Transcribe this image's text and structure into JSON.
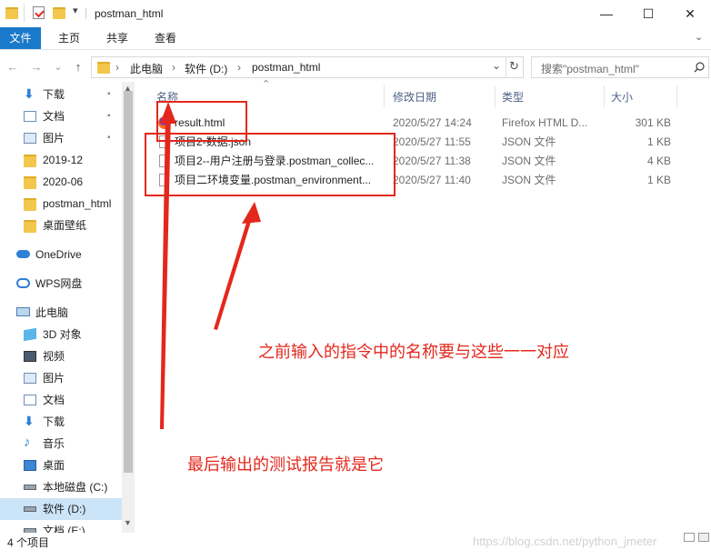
{
  "titlebar": {
    "title": "postman_html",
    "minimize_glyph": "—",
    "maximize_glyph": "☐",
    "close_glyph": "✕"
  },
  "ribbon": {
    "tabs": [
      "文件",
      "主页",
      "共享",
      "查看"
    ]
  },
  "nav": {
    "back_glyph": "←",
    "forward_glyph": "→",
    "recent_glyph": "⌄",
    "up_glyph": "↑",
    "breadcrumb": [
      "此电脑",
      "软件 (D:)",
      "postman_html"
    ],
    "separator": "›",
    "dropdown_glyph": "⌄",
    "refresh_glyph": "↻",
    "search_placeholder": "搜索\"postman_html\"",
    "search_icon": "search-icon"
  },
  "sidebar": {
    "items": [
      {
        "label": "下载",
        "icon": "download-icon",
        "pinned": true
      },
      {
        "label": "文档",
        "icon": "document-icon",
        "pinned": true
      },
      {
        "label": "图片",
        "icon": "picture-icon",
        "pinned": true
      },
      {
        "label": "2019-12",
        "icon": "folder-icon"
      },
      {
        "label": "2020-06",
        "icon": "folder-icon"
      },
      {
        "label": "postman_html",
        "icon": "folder-icon"
      },
      {
        "label": "桌面壁纸",
        "icon": "folder-icon"
      },
      {
        "label": "OneDrive",
        "icon": "cloud-icon"
      },
      {
        "label": "WPS网盘",
        "icon": "wps-cloud-icon"
      },
      {
        "label": "此电脑",
        "icon": "computer-icon"
      },
      {
        "label": "3D 对象",
        "icon": "3d-objects-icon"
      },
      {
        "label": "视频",
        "icon": "video-icon"
      },
      {
        "label": "图片",
        "icon": "picture-icon"
      },
      {
        "label": "文档",
        "icon": "document-icon"
      },
      {
        "label": "下载",
        "icon": "download-icon"
      },
      {
        "label": "音乐",
        "icon": "music-icon"
      },
      {
        "label": "桌面",
        "icon": "desktop-icon"
      },
      {
        "label": "本地磁盘 (C:)",
        "icon": "drive-icon"
      },
      {
        "label": "软件 (D:)",
        "icon": "drive-icon",
        "selected": true
      },
      {
        "label": "文档 (E:)",
        "icon": "drive-icon"
      }
    ],
    "pin_glyph": "📌"
  },
  "filelist": {
    "columns": [
      "名称",
      "修改日期",
      "类型",
      "大小"
    ],
    "sort_glyph": "⌃",
    "rows": [
      {
        "name": "result.html",
        "date": "2020/5/27 14:24",
        "type": "Firefox HTML D...",
        "size": "301 KB",
        "icon": "firefox-html-icon"
      },
      {
        "name": "项目2-数据.json",
        "date": "2020/5/27 11:55",
        "type": "JSON 文件",
        "size": "1 KB",
        "icon": "file-icon"
      },
      {
        "name": "项目2--用户注册与登录.postman_collec...",
        "date": "2020/5/27 11:38",
        "type": "JSON 文件",
        "size": "4 KB",
        "icon": "file-icon"
      },
      {
        "name": "项目二环境变量.postman_environment...",
        "date": "2020/5/27 11:40",
        "type": "JSON 文件",
        "size": "1 KB",
        "icon": "file-icon"
      }
    ]
  },
  "annotations": {
    "note1": "之前输入的指令中的名称要与这些一一对应",
    "note2": "最后输出的测试报告就是它",
    "color": "#e4271c"
  },
  "status": {
    "count": "4 个项目",
    "watermark": "https://blog.csdn.net/python_jmeter"
  },
  "colors": {
    "accent": "#1979ca",
    "selection": "#cce4f7",
    "folder": "#f3c64c"
  }
}
